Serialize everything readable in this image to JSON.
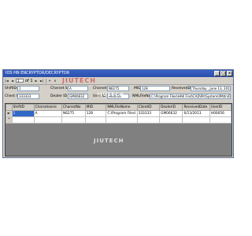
{
  "window": {
    "title": "IOS HN ENCRYPTOR/DECRYPTOR",
    "min": "_",
    "max": "□",
    "close": "x"
  },
  "toolbar": {
    "first": "|◄",
    "prev": "◄",
    "position": "1",
    "of": "of 1",
    "next": "►",
    "last": "►|",
    "add": "+",
    "delete": "x"
  },
  "form": {
    "shift_label": "ShiftID:",
    "shift_value": "1",
    "charset_label": "Charset Serie",
    "charset_value": "A",
    "charset_no_label": "Charset No",
    "charset_no_value": "N6275",
    "mid_label": "MID",
    "mid_value": "128",
    "received_label": "ReceivedDate",
    "received_value": "Thursday     ,  June    13, 2013",
    "client_label": "Client ID",
    "client_value": "333333",
    "dealer_label": "Dealer ID",
    "dealer_value": "GM06632",
    "user_label": "User ID",
    "user_value": "H00056",
    "filename_label": "NMLFileName",
    "filename_value": "C:\\Program Files\\HAK Find\\CAD\\Pit\\System\\IPAtIn\\FileDrop"
  },
  "grid": {
    "columns": [
      "ShiftID",
      "Charsetserie",
      "CharsetNo",
      "MID",
      "NMLFileName",
      "ClientID",
      "DealerID",
      "ReceivedDate",
      "UserID"
    ],
    "rows": [
      {
        "marker": "►",
        "cells": [
          "1",
          "A",
          "N6275",
          "128",
          "C:\\Program Files\\",
          "333333",
          "GM06632",
          "6/13/2013",
          "H00056"
        ]
      },
      {
        "marker": "*",
        "cells": [
          "",
          "",
          "",
          "",
          "",
          "",
          "",
          "",
          ""
        ]
      }
    ]
  },
  "watermarks": {
    "top": "JIUTECH",
    "mid": "JIUTECH",
    "bottom": "JIUTECH"
  }
}
